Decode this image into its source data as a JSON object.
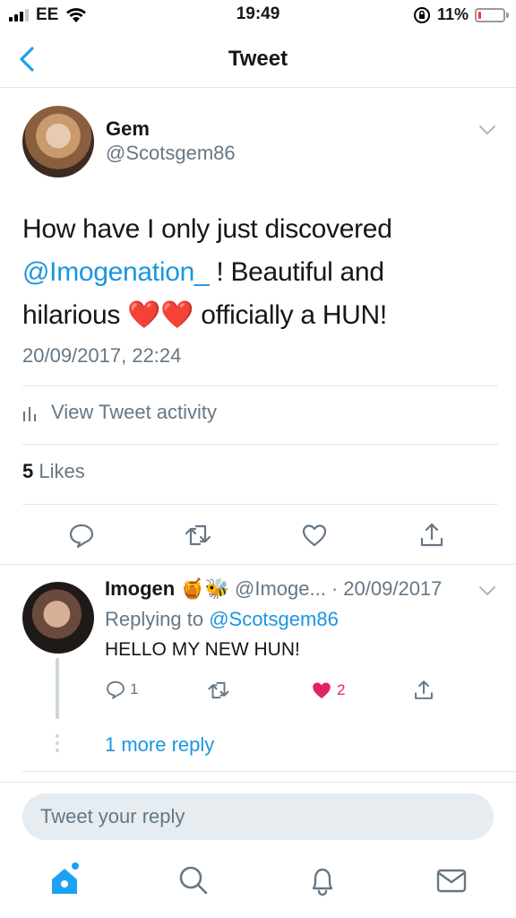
{
  "status_bar": {
    "carrier": "EE",
    "time": "19:49",
    "battery_percent": "11%",
    "battery_level": 0.11,
    "battery_color": "#ff3b30",
    "icons": [
      "signal-icon",
      "wifi-icon",
      "rotation-lock-icon",
      "battery-icon"
    ]
  },
  "nav": {
    "title": "Tweet",
    "back_icon": "chevron-left-icon"
  },
  "tweet": {
    "name": "Gem",
    "handle": "@Scotsgem86",
    "text_line1": "How have I only just discovered",
    "mention": "@Imogenation_",
    "text_line2_rest": " ! Beautiful and",
    "text_line3_start": "hilarious ",
    "emoji": "❤️❤️",
    "text_line3_end": " officially a HUN!",
    "timestamp": "20/09/2017, 22:24",
    "activity_label": "View Tweet activity",
    "likes_count": "5",
    "likes_label": " Likes",
    "actions": [
      "reply-icon",
      "retweet-icon",
      "like-icon",
      "share-icon"
    ]
  },
  "reply": {
    "name": "Imogen",
    "name_emoji": "🍯🐝",
    "handle_truncated": "@Imoge...",
    "date": "· 20/09/2017",
    "replying_prefix": "Replying to ",
    "replying_handle": "@Scotsgem86",
    "text": "HELLO MY NEW HUN!",
    "reply_count": "1",
    "like_count": "2",
    "more_replies": "1 more reply"
  },
  "compose": {
    "placeholder": "Tweet your reply"
  },
  "tab_bar": {
    "items": [
      "home-icon",
      "search-icon",
      "notifications-icon",
      "messages-icon"
    ]
  },
  "colors": {
    "accent": "#1da1f2",
    "link": "#1b95e0",
    "secondary_text": "#657786",
    "like": "#e0245e"
  }
}
